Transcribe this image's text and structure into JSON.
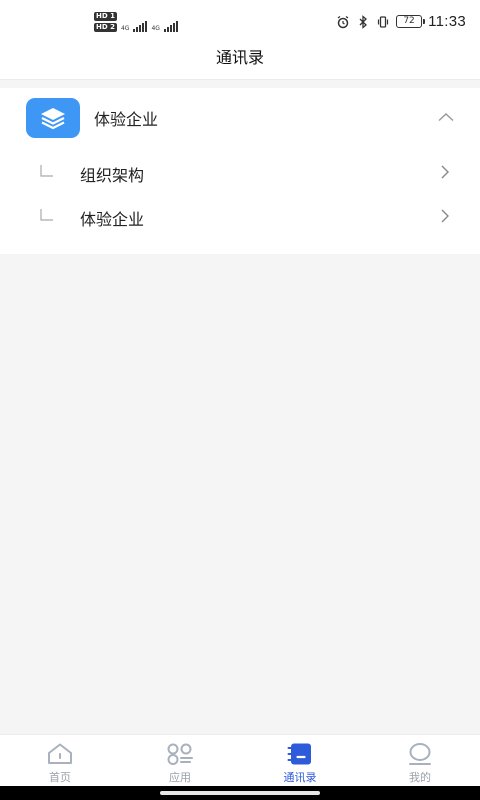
{
  "status_bar": {
    "sim1": "HD 1",
    "sim2": "HD 2",
    "network1": "4G",
    "network2": "4G",
    "battery": "72",
    "time": "11:33"
  },
  "header": {
    "title": "通讯录"
  },
  "organization": {
    "name": "体验企业",
    "expanded": true,
    "items": [
      {
        "label": "组织架构"
      },
      {
        "label": "体验企业"
      }
    ]
  },
  "bottom_nav": {
    "active": "通讯录",
    "items": [
      {
        "label": "首页",
        "icon": "home-icon"
      },
      {
        "label": "应用",
        "icon": "apps-icon"
      },
      {
        "label": "通讯录",
        "icon": "contacts-icon"
      },
      {
        "label": "我的",
        "icon": "profile-icon"
      }
    ]
  },
  "colors": {
    "accent": "#2d5bd9",
    "logo": "#3e97f5",
    "inactive": "#9aa0aa",
    "background": "#f5f5f5"
  }
}
